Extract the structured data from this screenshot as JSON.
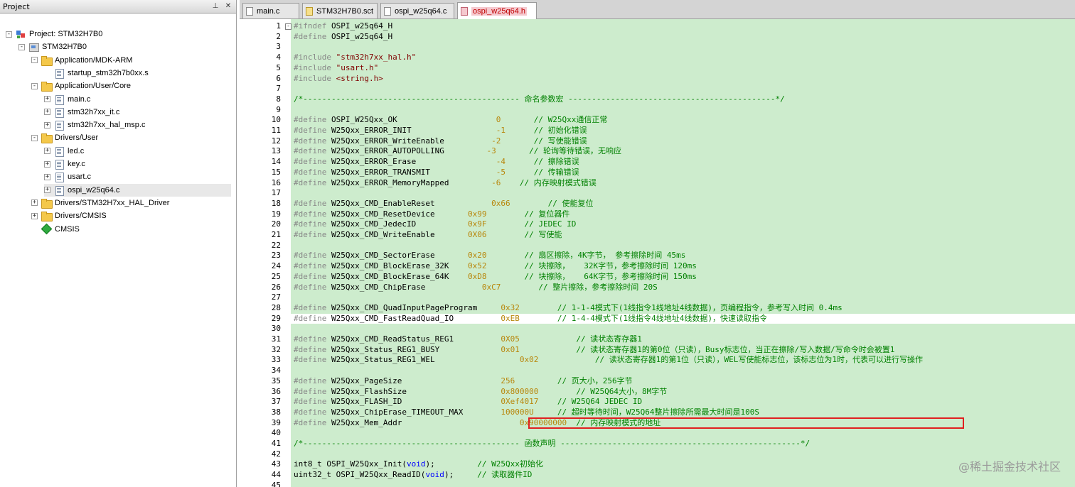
{
  "project_panel": {
    "title": "Project",
    "pin_glyph": "⊥",
    "close_glyph": "✕",
    "tree": [
      {
        "label": "Project: STM32H7B0",
        "depth": 0,
        "icon": "project-icon",
        "expander": "-"
      },
      {
        "label": "STM32H7B0",
        "depth": 1,
        "icon": "target-icon",
        "expander": "-"
      },
      {
        "label": "Application/MDK-ARM",
        "depth": 2,
        "icon": "folder-icon",
        "expander": "-"
      },
      {
        "label": "startup_stm32h7b0xx.s",
        "depth": 3,
        "icon": "file-icon",
        "expander": ""
      },
      {
        "label": "Application/User/Core",
        "depth": 2,
        "icon": "folder-icon",
        "expander": "-"
      },
      {
        "label": "main.c",
        "depth": 3,
        "icon": "file-icon",
        "expander": "+"
      },
      {
        "label": "stm32h7xx_it.c",
        "depth": 3,
        "icon": "file-icon",
        "expander": "+"
      },
      {
        "label": "stm32h7xx_hal_msp.c",
        "depth": 3,
        "icon": "file-icon",
        "expander": "+"
      },
      {
        "label": "Drivers/User",
        "depth": 2,
        "icon": "folder-icon",
        "expander": "-"
      },
      {
        "label": "led.c",
        "depth": 3,
        "icon": "file-icon",
        "expander": "+"
      },
      {
        "label": "key.c",
        "depth": 3,
        "icon": "file-icon",
        "expander": "+"
      },
      {
        "label": "usart.c",
        "depth": 3,
        "icon": "file-icon",
        "expander": "+"
      },
      {
        "label": "ospi_w25q64.c",
        "depth": 3,
        "icon": "file-icon",
        "expander": "+",
        "selected": true
      },
      {
        "label": "Drivers/STM32H7xx_HAL_Driver",
        "depth": 2,
        "icon": "folder-icon",
        "expander": "+"
      },
      {
        "label": "Drivers/CMSIS",
        "depth": 2,
        "icon": "folder-icon",
        "expander": "+"
      },
      {
        "label": "CMSIS",
        "depth": 2,
        "icon": "cmsis-icon",
        "expander": ""
      }
    ]
  },
  "tabs": [
    {
      "label": "main.c",
      "icon": "plain",
      "active": false
    },
    {
      "label": "STM32H7B0.sct",
      "icon": "yellow",
      "active": false
    },
    {
      "label": "ospi_w25q64.c",
      "icon": "plain",
      "active": false
    },
    {
      "label": "ospi_w25q64.h",
      "icon": "pink",
      "active": true
    }
  ],
  "editor": {
    "current_line": 29,
    "highlighted_line": 39,
    "lines": [
      {
        "n": "1",
        "fold": "-",
        "tokens": [
          [
            "pp",
            "#ifndef"
          ],
          [
            "t",
            " OSPI_w25q64_H"
          ]
        ]
      },
      {
        "n": "2",
        "tokens": [
          [
            "pp",
            "#define"
          ],
          [
            "t",
            " OSPI_w25q64_H"
          ]
        ]
      },
      {
        "n": "3",
        "tokens": []
      },
      {
        "n": "4",
        "tokens": [
          [
            "pp",
            "#include"
          ],
          [
            "t",
            " "
          ],
          [
            "str",
            "\"stm32h7xx_hal.h\""
          ]
        ]
      },
      {
        "n": "5",
        "tokens": [
          [
            "pp",
            "#include"
          ],
          [
            "t",
            " "
          ],
          [
            "str",
            "\"usart.h\""
          ]
        ]
      },
      {
        "n": "6",
        "tokens": [
          [
            "pp",
            "#include"
          ],
          [
            "t",
            " "
          ],
          [
            "str",
            "<string.h>"
          ]
        ]
      },
      {
        "n": "7",
        "tokens": []
      },
      {
        "n": "8",
        "tokens": [
          [
            "cm",
            "/*---------------------------------------------- 命名参数宏 --------------------------------------------*/"
          ]
        ]
      },
      {
        "n": "9",
        "tokens": []
      },
      {
        "n": "10",
        "tokens": [
          [
            "pp",
            "#define"
          ],
          [
            "t",
            " OSPI_W25Qxx_OK                     "
          ],
          [
            "num",
            "0"
          ],
          [
            "t",
            "       "
          ],
          [
            "cm",
            "// W25Qxx通信正常"
          ]
        ]
      },
      {
        "n": "11",
        "tokens": [
          [
            "pp",
            "#define"
          ],
          [
            "t",
            " W25Qxx_ERROR_INIT                  "
          ],
          [
            "num",
            "-1"
          ],
          [
            "t",
            "      "
          ],
          [
            "cm",
            "// 初始化错误"
          ]
        ]
      },
      {
        "n": "12",
        "tokens": [
          [
            "pp",
            "#define"
          ],
          [
            "t",
            " W25Qxx_ERROR_WriteEnable          "
          ],
          [
            "num",
            "-2"
          ],
          [
            "t",
            "       "
          ],
          [
            "cm",
            "// 写使能错误"
          ]
        ]
      },
      {
        "n": "13",
        "tokens": [
          [
            "pp",
            "#define"
          ],
          [
            "t",
            " W25Qxx_ERROR_AUTOPOLLING         "
          ],
          [
            "num",
            "-3"
          ],
          [
            "t",
            "       "
          ],
          [
            "cm",
            "// 轮询等待错误，无响应"
          ]
        ]
      },
      {
        "n": "14",
        "tokens": [
          [
            "pp",
            "#define"
          ],
          [
            "t",
            " W25Qxx_ERROR_Erase                 "
          ],
          [
            "num",
            "-4"
          ],
          [
            "t",
            "      "
          ],
          [
            "cm",
            "// 擦除错误"
          ]
        ]
      },
      {
        "n": "15",
        "tokens": [
          [
            "pp",
            "#define"
          ],
          [
            "t",
            " W25Qxx_ERROR_TRANSMIT              "
          ],
          [
            "num",
            "-5"
          ],
          [
            "t",
            "      "
          ],
          [
            "cm",
            "// 传输错误"
          ]
        ]
      },
      {
        "n": "16",
        "tokens": [
          [
            "pp",
            "#define"
          ],
          [
            "t",
            " W25Qxx_ERROR_MemoryMapped         "
          ],
          [
            "num",
            "-6"
          ],
          [
            "t",
            "    "
          ],
          [
            "cm",
            "// 内存映射模式错误"
          ]
        ]
      },
      {
        "n": "17",
        "tokens": []
      },
      {
        "n": "18",
        "tokens": [
          [
            "pp",
            "#define"
          ],
          [
            "t",
            " W25Qxx_CMD_EnableReset            "
          ],
          [
            "num",
            "0x66"
          ],
          [
            "t",
            "        "
          ],
          [
            "cm",
            "// 使能复位"
          ]
        ]
      },
      {
        "n": "19",
        "tokens": [
          [
            "pp",
            "#define"
          ],
          [
            "t",
            " W25Qxx_CMD_ResetDevice       "
          ],
          [
            "num",
            "0x99"
          ],
          [
            "t",
            "        "
          ],
          [
            "cm",
            "// 复位器件"
          ]
        ]
      },
      {
        "n": "20",
        "tokens": [
          [
            "pp",
            "#define"
          ],
          [
            "t",
            " W25Qxx_CMD_JedecID           "
          ],
          [
            "num",
            "0x9F"
          ],
          [
            "t",
            "        "
          ],
          [
            "cm",
            "// JEDEC ID"
          ]
        ]
      },
      {
        "n": "21",
        "tokens": [
          [
            "pp",
            "#define"
          ],
          [
            "t",
            " W25Qxx_CMD_WriteEnable       "
          ],
          [
            "num",
            "0X06"
          ],
          [
            "t",
            "        "
          ],
          [
            "cm",
            "// 写使能"
          ]
        ]
      },
      {
        "n": "22",
        "tokens": []
      },
      {
        "n": "23",
        "tokens": [
          [
            "pp",
            "#define"
          ],
          [
            "t",
            " W25Qxx_CMD_SectorErase       "
          ],
          [
            "num",
            "0x20"
          ],
          [
            "t",
            "        "
          ],
          [
            "cm",
            "// 扇区擦除，4K字节， 参考擦除时间 45ms"
          ]
        ]
      },
      {
        "n": "24",
        "tokens": [
          [
            "pp",
            "#define"
          ],
          [
            "t",
            " W25Qxx_CMD_BlockErase_32K    "
          ],
          [
            "num",
            "0x52"
          ],
          [
            "t",
            "        "
          ],
          [
            "cm",
            "// 块擦除，   32K字节，参考擦除时间 120ms"
          ]
        ]
      },
      {
        "n": "25",
        "tokens": [
          [
            "pp",
            "#define"
          ],
          [
            "t",
            " W25Qxx_CMD_BlockErase_64K    "
          ],
          [
            "num",
            "0xD8"
          ],
          [
            "t",
            "        "
          ],
          [
            "cm",
            "// 块擦除，   64K字节，参考擦除时间 150ms"
          ]
        ]
      },
      {
        "n": "26",
        "tokens": [
          [
            "pp",
            "#define"
          ],
          [
            "t",
            " W25Qxx_CMD_ChipErase            "
          ],
          [
            "num",
            "0xC7"
          ],
          [
            "t",
            "        "
          ],
          [
            "cm",
            "// 整片擦除，参考擦除时间 20S"
          ]
        ]
      },
      {
        "n": "27",
        "tokens": []
      },
      {
        "n": "28",
        "tokens": [
          [
            "pp",
            "#define"
          ],
          [
            "t",
            " W25Qxx_CMD_QuadInputPageProgram     "
          ],
          [
            "num",
            "0x32"
          ],
          [
            "t",
            "        "
          ],
          [
            "cm",
            "// 1-1-4模式下(1线指令1线地址4线数据)，页编程指令，参考写入时间 0.4ms"
          ]
        ]
      },
      {
        "n": "29",
        "tokens": [
          [
            "pp",
            "#define"
          ],
          [
            "t",
            " W25Qxx_CMD_FastReadQuad_IO          "
          ],
          [
            "num",
            "0xEB"
          ],
          [
            "t",
            "        "
          ],
          [
            "cm",
            "// 1-4-4模式下(1线指令4线地址4线数据)，快速读取指令"
          ]
        ]
      },
      {
        "n": "30",
        "tokens": []
      },
      {
        "n": "31",
        "tokens": [
          [
            "pp",
            "#define"
          ],
          [
            "t",
            " W25Qxx_CMD_ReadStatus_REG1          "
          ],
          [
            "num",
            "0X05"
          ],
          [
            "t",
            "            "
          ],
          [
            "cm",
            "// 读状态寄存器1"
          ]
        ]
      },
      {
        "n": "32",
        "tokens": [
          [
            "pp",
            "#define"
          ],
          [
            "t",
            " W25Qxx_Status_REG1_BUSY             "
          ],
          [
            "num",
            "0x01"
          ],
          [
            "t",
            "            "
          ],
          [
            "cm",
            "// 读状态寄存器1的第0位（只读），Busy标志位，当正在擦除/写入数据/写命令时会被置1"
          ]
        ]
      },
      {
        "n": "33",
        "tokens": [
          [
            "pp",
            "#define"
          ],
          [
            "t",
            " W25Qxx_Status_REG1_WEL                  "
          ],
          [
            "num",
            "0x02"
          ],
          [
            "t",
            "            "
          ],
          [
            "cm",
            "// 读状态寄存器1的第1位（只读），WEL写使能标志位，该标志位为1时，代表可以进行写操作"
          ]
        ]
      },
      {
        "n": "34",
        "tokens": []
      },
      {
        "n": "35",
        "tokens": [
          [
            "pp",
            "#define"
          ],
          [
            "t",
            " W25Qxx_PageSize                     "
          ],
          [
            "num",
            "256"
          ],
          [
            "t",
            "         "
          ],
          [
            "cm",
            "// 页大小，256字节"
          ]
        ]
      },
      {
        "n": "36",
        "tokens": [
          [
            "pp",
            "#define"
          ],
          [
            "t",
            " W25Qxx_FlashSize                    "
          ],
          [
            "num",
            "0x800000"
          ],
          [
            "t",
            "        "
          ],
          [
            "cm",
            "// W25Q64大小，8M字节"
          ]
        ]
      },
      {
        "n": "37",
        "tokens": [
          [
            "pp",
            "#define"
          ],
          [
            "t",
            " W25Qxx_FLASH_ID                     "
          ],
          [
            "num",
            "0Xef4017"
          ],
          [
            "t",
            "    "
          ],
          [
            "cm",
            "// W25Q64 JEDEC ID"
          ]
        ]
      },
      {
        "n": "38",
        "tokens": [
          [
            "pp",
            "#define"
          ],
          [
            "t",
            " W25Qxx_ChipErase_TIMEOUT_MAX        "
          ],
          [
            "num",
            "100000U"
          ],
          [
            "t",
            "     "
          ],
          [
            "cm",
            "// 超时等待时间，W25Q64整片擦除所需最大时间是100S"
          ]
        ]
      },
      {
        "n": "39",
        "tokens": [
          [
            "pp",
            "#define"
          ],
          [
            "t",
            " W25Qxx_Mem_Addr                         "
          ],
          [
            "num",
            "0x90000000"
          ],
          [
            "t",
            "  "
          ],
          [
            "cm",
            "// 内存映射模式的地址"
          ]
        ]
      },
      {
        "n": "40",
        "tokens": []
      },
      {
        "n": "41",
        "tokens": [
          [
            "cm",
            "/*---------------------------------------------- 函数声明 ---------------------------------------------------*/"
          ]
        ]
      },
      {
        "n": "42",
        "tokens": []
      },
      {
        "n": "43",
        "tokens": [
          [
            "t",
            "int8_t OSPI_W25Qxx_Init("
          ],
          [
            "kw",
            "void"
          ],
          [
            "t",
            ");         "
          ],
          [
            "cm",
            "// W25Qxx初始化"
          ]
        ]
      },
      {
        "n": "44",
        "tokens": [
          [
            "t",
            "uint32_t OSPI_W25Qxx_ReadID("
          ],
          [
            "kw",
            "void"
          ],
          [
            "t",
            ");     "
          ],
          [
            "cm",
            "// 读取器件ID"
          ]
        ]
      },
      {
        "n": "45",
        "tokens": []
      }
    ]
  },
  "watermark": "@稀土掘金技术社区"
}
